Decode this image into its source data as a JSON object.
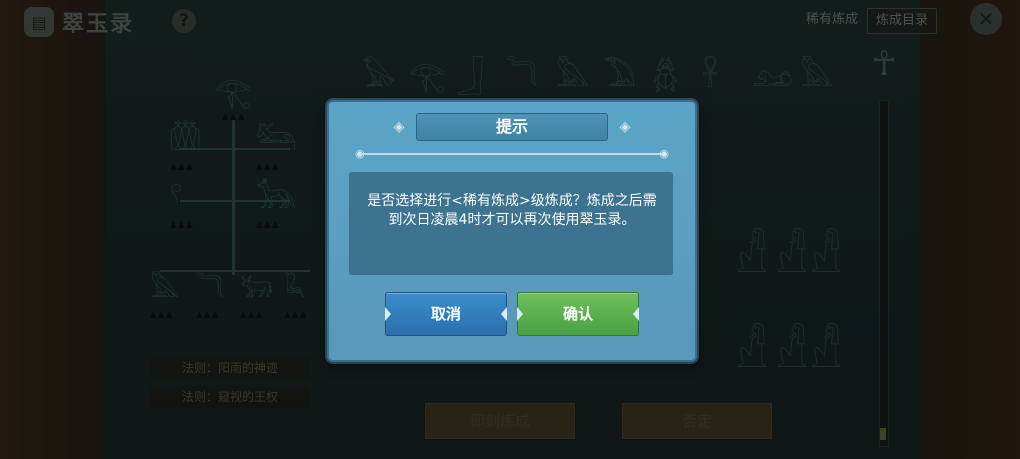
{
  "header": {
    "logo_icon": "notebook-icon",
    "title": "翠玉录",
    "help_label": "?",
    "tabs": [
      "稀有炼成",
      "炼成目录"
    ],
    "close_icon": "×"
  },
  "rules": [
    "法则：阳雨的神迹",
    "法则：窥视的王权"
  ],
  "bottom": {
    "craft_label": "即刻炼成",
    "reject_label": "否定"
  },
  "glyphs": {
    "top_row": [
      "𓅃",
      "𓂀",
      "𓃀",
      "𓆓",
      "𓅓",
      "𓅐",
      "𓆣",
      "𓋹",
      "𓃭",
      "𓅓"
    ],
    "tree": [
      "𓂀",
      "𓏃",
      "𓃛",
      "𓍢",
      "𓃥",
      "𓅓",
      "𓆓",
      "𓃒",
      "𓆗"
    ],
    "ankh": "☥",
    "statue": "𓀭"
  },
  "dialog": {
    "title": "提示",
    "message": "是否选择进行<稀有炼成>级炼成？炼成之后需到次日凌晨4时才可以再次使用翠玉录。",
    "cancel_label": "取消",
    "confirm_label": "确认"
  },
  "colors": {
    "cancel": "#2f7cbf",
    "confirm": "#56ab4a",
    "dialog": "#5aa0c2"
  }
}
